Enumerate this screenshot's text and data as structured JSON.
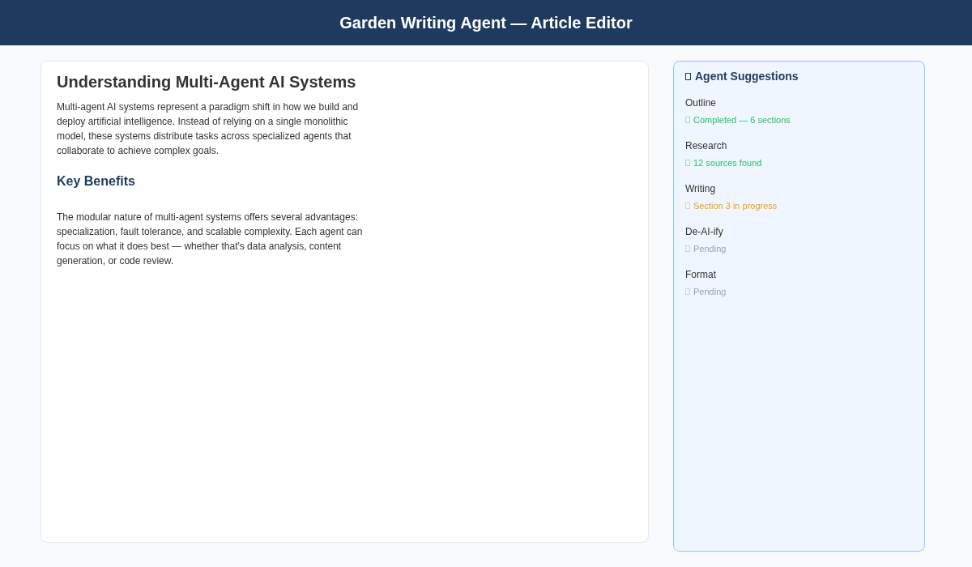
{
  "header": {
    "title": "Garden Writing Agent — Article Editor"
  },
  "article": {
    "title": "Understanding Multi-Agent AI Systems",
    "blocks": [
      {
        "kind": "paragraph",
        "text": "Multi-agent AI systems represent a paradigm shift in how we build and deploy artificial intelligence. Instead of relying on a single monolithic model, these systems distribute tasks across specialized agents that collaborate to achieve complex goals."
      },
      {
        "kind": "heading",
        "text": "Key Benefits"
      },
      {
        "kind": "paragraph",
        "text": "The modular nature of multi-agent systems offers several advantages: specialization, fault tolerance, and scalable complexity. Each agent can focus on what it does best — whether that's data analysis, content generation, or code review."
      }
    ]
  },
  "suggestions": {
    "title": "Agent Suggestions",
    "items": [
      {
        "name": "Outline",
        "status": "Completed — 6 sections",
        "color": "#22c55e"
      },
      {
        "name": "Research",
        "status": "12 sources found",
        "color": "#22c55e"
      },
      {
        "name": "Writing",
        "status": "Section 3 in progress",
        "color": "#f59e0b"
      },
      {
        "name": "De-AI-ify",
        "status": "Pending",
        "color": "#9ca3af"
      },
      {
        "name": "Format",
        "status": "Pending",
        "color": "#9ca3af"
      }
    ]
  }
}
